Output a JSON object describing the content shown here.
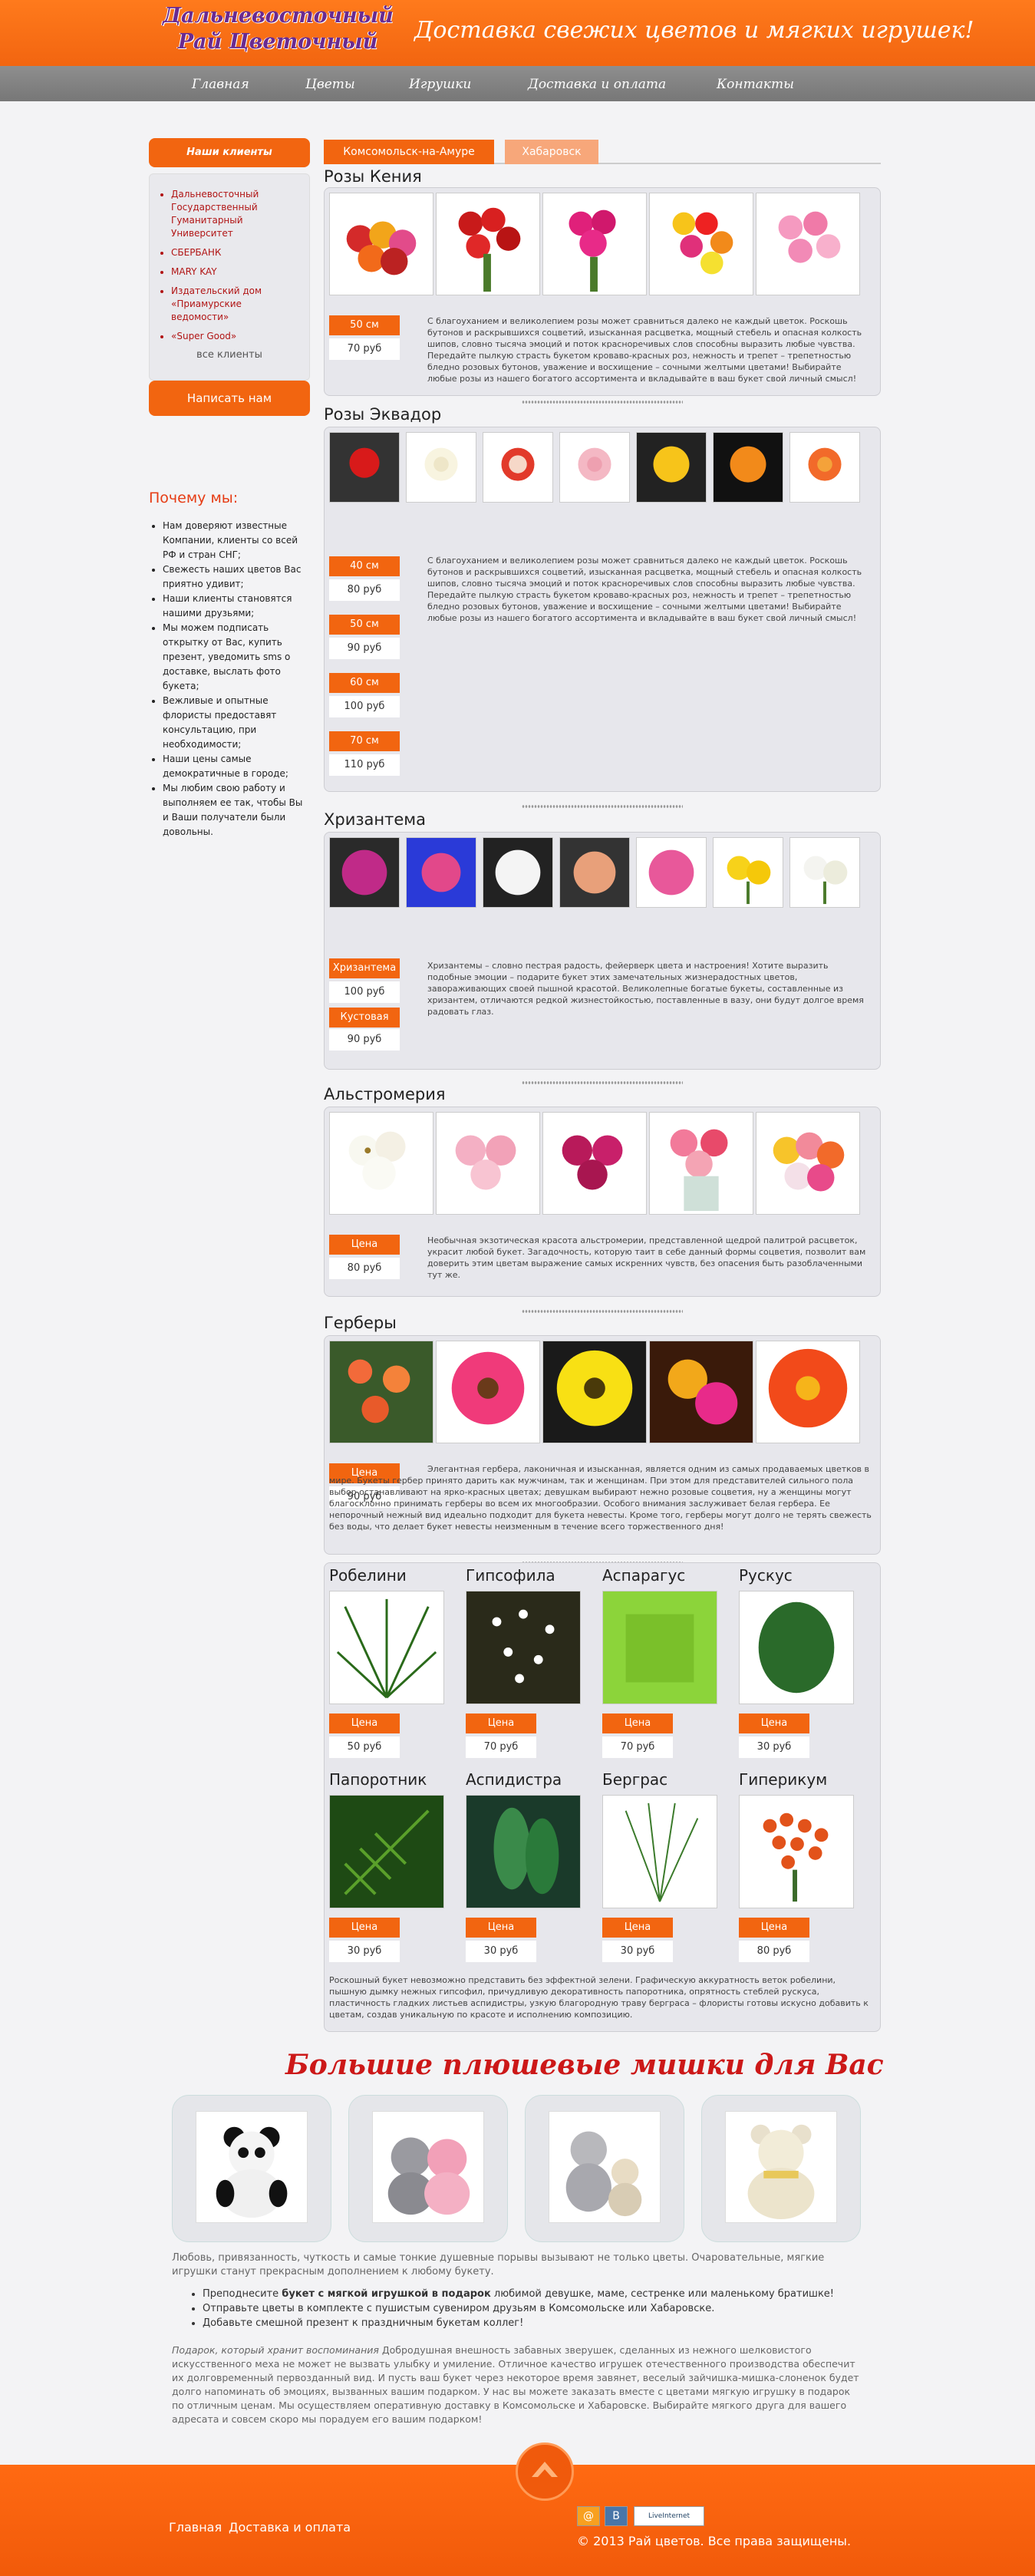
{
  "header": {
    "logo_line1": "Дальневосточный",
    "logo_line2": "Рай Цветочный",
    "tagline": "Доставка свежих цветов и мягких игрушек!",
    "brand_color": "#f26510"
  },
  "nav": [
    "Главная",
    "Цветы",
    "Игрушки",
    "Доставка и оплата",
    "Контакты"
  ],
  "sidebar": {
    "clients_title": "Наши клиенты",
    "clients": [
      "Дальневосточный Государственный Гуманитарный Университет",
      "СБЕРБАНК",
      "MARY KAY",
      "Издательский дом «Приамурские ведомости»",
      "«Super Good»"
    ],
    "all_clients": "все клиенты",
    "write_button": "Написать нам",
    "why_title": "Почему мы:",
    "why_items": [
      "Нам доверяют известные Компании, клиенты со всей РФ и стран СНГ;",
      "Свежесть наших цветов Вас приятно удивит;",
      "Наши клиенты становятся нашими друзьями;",
      "Мы можем подписать открытку от Вас, купить презент, уведомить sms о доставке, выслать фото букета;",
      "Вежливые и опытные флористы предоставят консультацию, при необходимости;",
      "Наши цены самые демократичные в городе;",
      "Мы любим свою работу и выполняем ее так, чтобы Вы и Ваши получатели были довольны."
    ]
  },
  "tabs": [
    "Комсомольск-на-Амуре",
    "Хабаровск"
  ],
  "sections": {
    "kenya": {
      "title": "Розы Кения",
      "prices": [
        {
          "label": "50 см",
          "value": "70 руб"
        }
      ],
      "desc": "С благоуханием и великолепием розы может сравниться далеко не каждый цветок. Роскошь бутонов и раскрывшихся соцветий, изысканная расцветка, мощный стебель и опасная колкость шипов, словно тысяча эмоций и поток красноречивых слов способны выразить любые чувства. Передайте пылкую страсть букетом кроваво-красных роз, нежность и трепет – трепетностью бледно розовых бутонов, уважение и восхищение – сочными желтыми цветами! Выбирайте любые розы из нашего богатого ассортимента и вкладывайте в ваш букет свой личный смысл!"
    },
    "ecuador": {
      "title": "Розы Эквадор",
      "prices": [
        {
          "label": "40 см",
          "value": "80 руб"
        },
        {
          "label": "50 см",
          "value": "90 руб"
        },
        {
          "label": "60 см",
          "value": "100 руб"
        },
        {
          "label": "70 см",
          "value": "110 руб"
        }
      ],
      "desc": "С благоуханием и великолепием розы может сравниться далеко не каждый цветок. Роскошь бутонов и раскрывшихся соцветий, изысканная расцветка, мощный стебель и опасная колкость шипов, словно тысяча эмоций и поток красноречивых слов способны выразить любые чувства. Передайте пылкую страсть букетом кроваво-красных роз, нежность и трепет – трепетностью бледно розовых бутонов, уважение и восхищение – сочными желтыми цветами! Выбирайте любые розы из нашего богатого ассортимента и вкладывайте в ваш букет свой личный смысл!"
    },
    "chrysanthemum": {
      "title": "Хризантема",
      "prices": [
        {
          "label": "Хризантема",
          "value": "100 руб"
        },
        {
          "label": "Кустовая",
          "value": "90 руб"
        }
      ],
      "desc": "Хризантемы – словно пестрая радость, фейерверк цвета и настроения! Хотите выразить подобные эмоции – подарите букет этих замечательных жизнерадостных цветов, завораживающих своей пышной красотой. Великолепные богатые букеты, составленные из хризантем, отличаются редкой жизнестойкостью, поставленные в вазу, они будут долгое время радовать глаз."
    },
    "alstroemeria": {
      "title": "Альстромерия",
      "prices": [
        {
          "label": "Цена",
          "value": "80 руб"
        }
      ],
      "desc": "Необычная экзотическая красота альстромерии, представленной щедрой палитрой расцветок, украсит любой букет. Загадочность, которую таит в себе данный формы соцветия, позволит вам доверить этим цветам выражение самых искренних чувств, без опасения быть разоблаченными тут же."
    },
    "gerbera": {
      "title": "Герберы",
      "prices": [
        {
          "label": "Цена",
          "value": "90 руб"
        }
      ],
      "desc": "Элегантная гербера, лаконичная и изысканная, является одним из самых продаваемых цветков в мире. Букеты гербер принято дарить как мужчинам, так и женщинам. При этом для представителей сильного пола выбор останавливают на ярко-красных цветах; девушкам выбирают нежно розовые соцветия, ну а женщины могут благосклонно принимать герберы во всем их многообразии. Особого внимания заслуживает белая гербера. Ее непорочный нежный вид идеально подходит для букета невесты. Кроме того, герберы могут долго не терять свежесть без воды, что делает букет невесты неизменным в течение всего торжественного дня!"
    }
  },
  "greens": {
    "items": [
      {
        "name": "Робелини",
        "label": "Цена",
        "value": "50 руб"
      },
      {
        "name": "Гипсофила",
        "label": "Цена",
        "value": "70 руб"
      },
      {
        "name": "Аспарагус",
        "label": "Цена",
        "value": "70 руб"
      },
      {
        "name": "Рускус",
        "label": "Цена",
        "value": "30 руб"
      },
      {
        "name": "Папоротник",
        "label": "Цена",
        "value": "30 руб"
      },
      {
        "name": "Аспидистра",
        "label": "Цена",
        "value": "30 руб"
      },
      {
        "name": "Берграс",
        "label": "Цена",
        "value": "30 руб"
      },
      {
        "name": "Гиперикум",
        "label": "Цена",
        "value": "80 руб"
      }
    ],
    "desc": "Роскошный букет невозможно представить без эффектной зелени. Графическую аккуратность веток робелини, пышную дымку нежных гипсофил, причудливую декоративность папоротника, опрятность стеблей рускуса, пластичность гладких листьев аспидистры, узкую благородную траву берграса – флористы готовы искусно добавить к цветам, создав уникальную по красоте и исполнению композицию."
  },
  "bears": {
    "title": "Большие плюшевые мишки для Вас",
    "para1": "Любовь, привязанность, чуткость и самые тонкие душевные порывы вызывают не только цветы. Очаровательные, мягкие игрушки станут прекрасным дополнением к любому букету.",
    "bullet1_bold": "букет с мягкой игрушкой в подарок",
    "bullet1_pre": "Преподнесите ",
    "bullet1_post": " любимой девушке, маме, сестренке или маленькому братишке!",
    "bullet2": "Отправьте цветы в комплекте с пушистым сувениром друзьям в Комсомольске или Хабаровске.",
    "bullet3": "Добавьте смешной презент к праздничным букетам коллег!",
    "para2_italic": "Подарок, который хранит воспоминания",
    "para2": " Добродушная внешность забавных зверушек, сделанных из нежного шелковистого искусственного меха не может не вызвать улыбку и умиление. Отличное качество игрушек отечественного производства обеспечит их долговременный первозданный вид. И пусть ваш букет через некоторое время завянет, веселый зайчишка-мишка-слоненок будет долго напоминать об эмоциях, вызванных вашим подарком.   У нас вы можете заказать вместе с цветами мягкую игрушку в подарок по отличным ценам. Мы осуществляем оперативную доставку в Комсомольске и Хабаровске. Выбирайте мягкого друга для вашего адресата и совсем скоро мы порадуем его вашим подарком!"
  },
  "footer": {
    "links": [
      "Главная",
      "Доставка и оплата"
    ],
    "copyright": "© 2013 Рай цветов. Все права защищены.",
    "badge1": "@",
    "badge2": "В",
    "badge3": "LiveInternet"
  }
}
